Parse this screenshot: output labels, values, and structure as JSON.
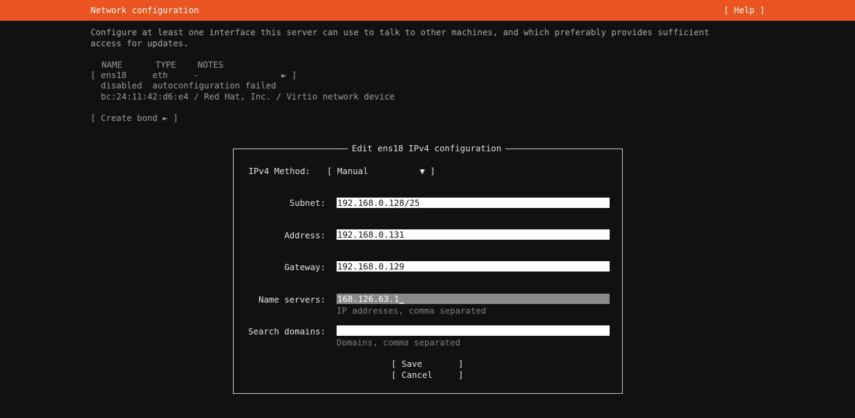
{
  "header": {
    "title": "Network configuration",
    "help": "[ Help ]",
    "background_color": "#e95420"
  },
  "intro": {
    "line1": "Configure at least one interface this server can use to talk to other machines, and which preferably provides sufficient",
    "line2": "access for updates."
  },
  "interfaces": {
    "headers": {
      "name": "NAME",
      "type": "TYPE",
      "notes": "NOTES"
    },
    "rows": [
      {
        "line1": "[ ens18     eth     -                ► ]",
        "line2": "  disabled  autoconfiguration failed",
        "line3": "  bc:24:11:42:d6:e4 / Red Hat, Inc. / Virtio network device"
      }
    ]
  },
  "create_bond": "[ Create bond ► ]",
  "dialog": {
    "title": "Edit ens18 IPv4 configuration",
    "method_label": "IPv4 Method:",
    "method_value": "[ Manual          ▼ ]",
    "subnet_label": "Subnet:",
    "subnet_value": "192.168.0.128/25",
    "address_label": "Address:",
    "address_value": "192.168.0.131",
    "gateway_label": "Gateway:",
    "gateway_value": "192.168.0.129",
    "nameservers_label": "Name servers:",
    "nameservers_value": "168.126.63.1",
    "nameservers_cursor": "_",
    "nameservers_hint": "IP addresses, comma separated",
    "search_label": "Search domains:",
    "search_value": "",
    "search_hint": "Domains, comma separated",
    "save": "[ Save       ]",
    "cancel": "[ Cancel     ]"
  }
}
